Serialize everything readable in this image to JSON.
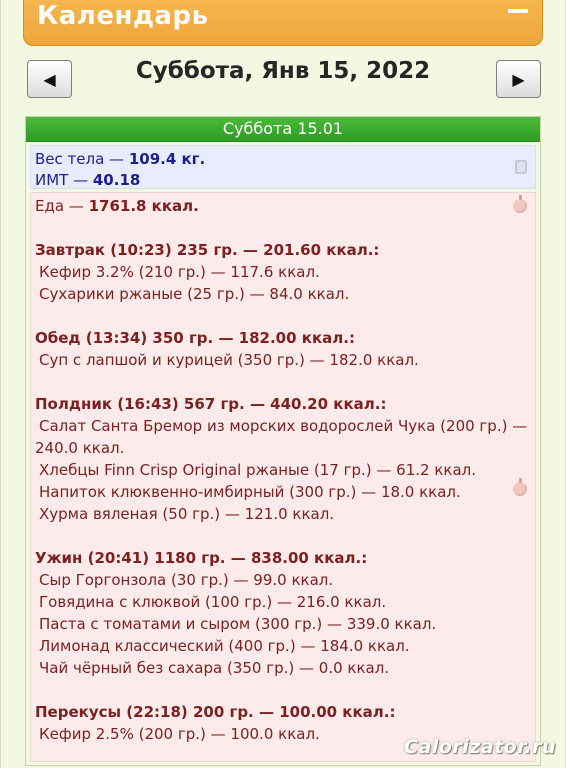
{
  "header": {
    "title": "Календарь"
  },
  "date_nav": {
    "prev_symbol": "◀",
    "next_symbol": "▶",
    "title": "Суббота, Янв 15, 2022"
  },
  "day": {
    "bar_title": "Суббота 15.01",
    "weight": {
      "label": "Вес тела — ",
      "value": "109.4 кг."
    },
    "bmi": {
      "label": "ИМТ — ",
      "value": "40.18"
    },
    "food_total": {
      "label": "Еда — ",
      "value": "1761.8 ккал."
    },
    "meals": [
      {
        "head": "Завтрак (10:23) 235 гр. — 201.60 ккал.:",
        "items": [
          "Кефир 3.2% (210 гр.) — 117.6 ккал.",
          "Сухарики ржаные (25 гр.) — 84.0 ккал."
        ]
      },
      {
        "head": "Обед (13:34) 350 гр. — 182.00 ккал.:",
        "items": [
          "Суп с лапшой и курицей (350 гр.) — 182.0 ккал."
        ]
      },
      {
        "head": "Полдник (16:43) 567 гр. — 440.20 ккал.:",
        "items": [
          "Салат Санта Бремор из морских водорослей Чука (200 гр.) —",
          "240.0 ккал.",
          "Хлебцы Finn Crisp Original ржаные (17 гр.) — 61.2 ккал.",
          "Напиток клюквенно-имбирный (300 гр.) — 18.0 ккал.",
          "Хурма вяленая (50 гр.) — 121.0 ккал."
        ]
      },
      {
        "head": "Ужин (20:41) 1180 гр. — 838.00 ккал.:",
        "items": [
          "Сыр Горгонзола (30 гр.) — 99.0 ккал.",
          "Говядина с клюквой (100 гр.) — 216.0 ккал.",
          "Паста с томатами и сыром (300 гр.) — 339.0 ккал.",
          "Лимонад классический (400 гр.) — 184.0 ккал.",
          "Чай чёрный без сахара (350 гр.) — 0.0 ккал."
        ]
      },
      {
        "head": "Перекусы (22:18) 200 гр. — 100.00 ккал.:",
        "items": [
          "Кефир 2.5% (200 гр.) — 100.0 ккал."
        ]
      }
    ]
  },
  "watermark": "Calorizator.ru"
}
